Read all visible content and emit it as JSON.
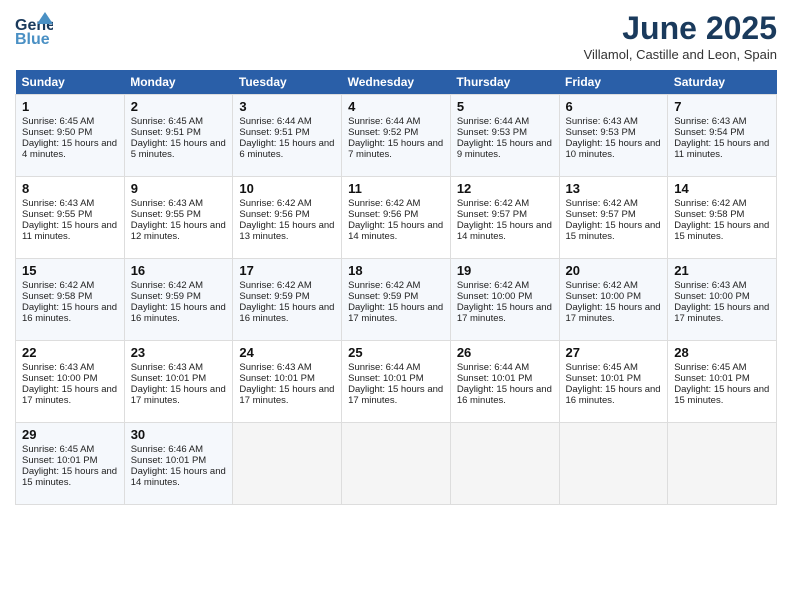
{
  "header": {
    "logo_general": "General",
    "logo_blue": "Blue",
    "month_title": "June 2025",
    "location": "Villamol, Castille and Leon, Spain"
  },
  "weekdays": [
    "Sunday",
    "Monday",
    "Tuesday",
    "Wednesday",
    "Thursday",
    "Friday",
    "Saturday"
  ],
  "rows": [
    [
      {
        "day": "1",
        "sunrise": "Sunrise: 6:45 AM",
        "sunset": "Sunset: 9:50 PM",
        "daylight": "Daylight: 15 hours and 4 minutes."
      },
      {
        "day": "2",
        "sunrise": "Sunrise: 6:45 AM",
        "sunset": "Sunset: 9:51 PM",
        "daylight": "Daylight: 15 hours and 5 minutes."
      },
      {
        "day": "3",
        "sunrise": "Sunrise: 6:44 AM",
        "sunset": "Sunset: 9:51 PM",
        "daylight": "Daylight: 15 hours and 6 minutes."
      },
      {
        "day": "4",
        "sunrise": "Sunrise: 6:44 AM",
        "sunset": "Sunset: 9:52 PM",
        "daylight": "Daylight: 15 hours and 7 minutes."
      },
      {
        "day": "5",
        "sunrise": "Sunrise: 6:44 AM",
        "sunset": "Sunset: 9:53 PM",
        "daylight": "Daylight: 15 hours and 9 minutes."
      },
      {
        "day": "6",
        "sunrise": "Sunrise: 6:43 AM",
        "sunset": "Sunset: 9:53 PM",
        "daylight": "Daylight: 15 hours and 10 minutes."
      },
      {
        "day": "7",
        "sunrise": "Sunrise: 6:43 AM",
        "sunset": "Sunset: 9:54 PM",
        "daylight": "Daylight: 15 hours and 11 minutes."
      }
    ],
    [
      {
        "day": "8",
        "sunrise": "Sunrise: 6:43 AM",
        "sunset": "Sunset: 9:55 PM",
        "daylight": "Daylight: 15 hours and 11 minutes."
      },
      {
        "day": "9",
        "sunrise": "Sunrise: 6:43 AM",
        "sunset": "Sunset: 9:55 PM",
        "daylight": "Daylight: 15 hours and 12 minutes."
      },
      {
        "day": "10",
        "sunrise": "Sunrise: 6:42 AM",
        "sunset": "Sunset: 9:56 PM",
        "daylight": "Daylight: 15 hours and 13 minutes."
      },
      {
        "day": "11",
        "sunrise": "Sunrise: 6:42 AM",
        "sunset": "Sunset: 9:56 PM",
        "daylight": "Daylight: 15 hours and 14 minutes."
      },
      {
        "day": "12",
        "sunrise": "Sunrise: 6:42 AM",
        "sunset": "Sunset: 9:57 PM",
        "daylight": "Daylight: 15 hours and 14 minutes."
      },
      {
        "day": "13",
        "sunrise": "Sunrise: 6:42 AM",
        "sunset": "Sunset: 9:57 PM",
        "daylight": "Daylight: 15 hours and 15 minutes."
      },
      {
        "day": "14",
        "sunrise": "Sunrise: 6:42 AM",
        "sunset": "Sunset: 9:58 PM",
        "daylight": "Daylight: 15 hours and 15 minutes."
      }
    ],
    [
      {
        "day": "15",
        "sunrise": "Sunrise: 6:42 AM",
        "sunset": "Sunset: 9:58 PM",
        "daylight": "Daylight: 15 hours and 16 minutes."
      },
      {
        "day": "16",
        "sunrise": "Sunrise: 6:42 AM",
        "sunset": "Sunset: 9:59 PM",
        "daylight": "Daylight: 15 hours and 16 minutes."
      },
      {
        "day": "17",
        "sunrise": "Sunrise: 6:42 AM",
        "sunset": "Sunset: 9:59 PM",
        "daylight": "Daylight: 15 hours and 16 minutes."
      },
      {
        "day": "18",
        "sunrise": "Sunrise: 6:42 AM",
        "sunset": "Sunset: 9:59 PM",
        "daylight": "Daylight: 15 hours and 17 minutes."
      },
      {
        "day": "19",
        "sunrise": "Sunrise: 6:42 AM",
        "sunset": "Sunset: 10:00 PM",
        "daylight": "Daylight: 15 hours and 17 minutes."
      },
      {
        "day": "20",
        "sunrise": "Sunrise: 6:42 AM",
        "sunset": "Sunset: 10:00 PM",
        "daylight": "Daylight: 15 hours and 17 minutes."
      },
      {
        "day": "21",
        "sunrise": "Sunrise: 6:43 AM",
        "sunset": "Sunset: 10:00 PM",
        "daylight": "Daylight: 15 hours and 17 minutes."
      }
    ],
    [
      {
        "day": "22",
        "sunrise": "Sunrise: 6:43 AM",
        "sunset": "Sunset: 10:00 PM",
        "daylight": "Daylight: 15 hours and 17 minutes."
      },
      {
        "day": "23",
        "sunrise": "Sunrise: 6:43 AM",
        "sunset": "Sunset: 10:01 PM",
        "daylight": "Daylight: 15 hours and 17 minutes."
      },
      {
        "day": "24",
        "sunrise": "Sunrise: 6:43 AM",
        "sunset": "Sunset: 10:01 PM",
        "daylight": "Daylight: 15 hours and 17 minutes."
      },
      {
        "day": "25",
        "sunrise": "Sunrise: 6:44 AM",
        "sunset": "Sunset: 10:01 PM",
        "daylight": "Daylight: 15 hours and 17 minutes."
      },
      {
        "day": "26",
        "sunrise": "Sunrise: 6:44 AM",
        "sunset": "Sunset: 10:01 PM",
        "daylight": "Daylight: 15 hours and 16 minutes."
      },
      {
        "day": "27",
        "sunrise": "Sunrise: 6:45 AM",
        "sunset": "Sunset: 10:01 PM",
        "daylight": "Daylight: 15 hours and 16 minutes."
      },
      {
        "day": "28",
        "sunrise": "Sunrise: 6:45 AM",
        "sunset": "Sunset: 10:01 PM",
        "daylight": "Daylight: 15 hours and 15 minutes."
      }
    ],
    [
      {
        "day": "29",
        "sunrise": "Sunrise: 6:45 AM",
        "sunset": "Sunset: 10:01 PM",
        "daylight": "Daylight: 15 hours and 15 minutes."
      },
      {
        "day": "30",
        "sunrise": "Sunrise: 6:46 AM",
        "sunset": "Sunset: 10:01 PM",
        "daylight": "Daylight: 15 hours and 14 minutes."
      },
      null,
      null,
      null,
      null,
      null
    ]
  ]
}
